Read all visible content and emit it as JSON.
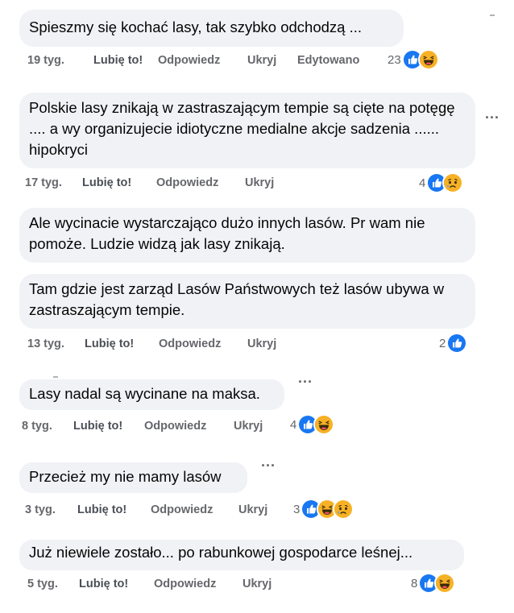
{
  "comments": [
    {
      "text": "Spieszmy się kochać lasy, tak szybko odchodzą ...",
      "time": "19 tyg.",
      "like": "Lubię to!",
      "reply": "Odpowiedz",
      "hide": "Ukryj",
      "edited": "Edytowano",
      "count": "23",
      "reactions": [
        "like-icon",
        "haha-icon"
      ]
    },
    {
      "text": "Polskie lasy znikają w zastraszającym tempie są cięte na potęgę .... a wy organizujecie idiotyczne medialne akcje sadzenia ...... hipokryci",
      "time": "17 tyg.",
      "like": "Lubię to!",
      "reply": "Odpowiedz",
      "hide": "Ukryj",
      "count": "4",
      "reactions": [
        "like-icon",
        "sad-icon"
      ],
      "more": "..."
    },
    {
      "text": "Ale wycinacie wystarczająco dużo innych lasów. Pr wam nie pomoże. Ludzie widzą jak lasy znikają."
    },
    {
      "text": "Tam gdzie jest zarząd Lasów Państwowych też lasów ubywa w zastraszającym tempie.",
      "time": "13 tyg.",
      "like": "Lubię to!",
      "reply": "Odpowiedz",
      "hide": "Ukryj",
      "count": "2",
      "reactions": [
        "like-icon"
      ]
    },
    {
      "text": "Lasy nadal są wycinane na maksa.",
      "time": "8 tyg.",
      "like": "Lubię to!",
      "reply": "Odpowiedz",
      "hide": "Ukryj",
      "count": "4",
      "reactions": [
        "like-icon",
        "haha-icon"
      ],
      "more": "..."
    },
    {
      "text": "Przecież my nie mamy lasów",
      "time": "3 tyg.",
      "like": "Lubię to!",
      "reply": "Odpowiedz",
      "hide": "Ukryj",
      "count": "3",
      "reactions": [
        "like-icon",
        "haha-icon",
        "sad-icon"
      ],
      "more": "..."
    },
    {
      "text": "Już niewiele zostało... po rabunkowej gospodarce leśnej...",
      "time": "5 tyg.",
      "like": "Lubię to!",
      "reply": "Odpowiedz",
      "hide": "Ukryj",
      "count": "8",
      "reactions": [
        "like-icon",
        "haha-icon"
      ]
    }
  ],
  "colors": {
    "bubble": "#f0f2f5",
    "meta": "#65676b",
    "like_blue": "#1877f2",
    "emoji_yellow": "#f7b125"
  }
}
